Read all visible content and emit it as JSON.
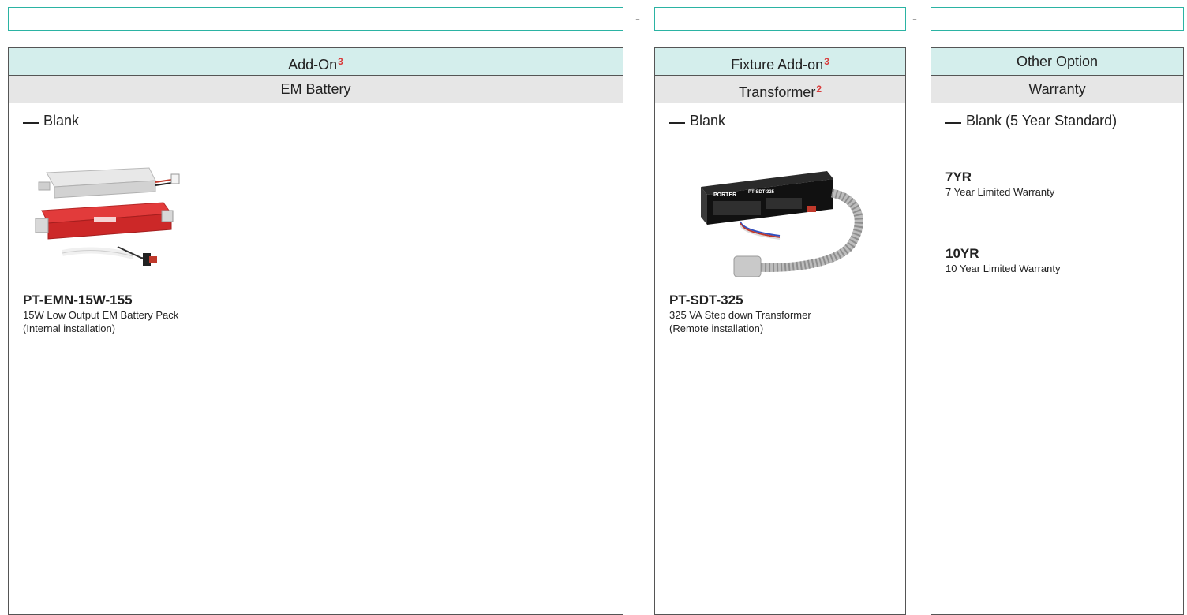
{
  "top_bar": {
    "input1": "",
    "input2": "",
    "input3": "",
    "sep1": "-",
    "sep2": "-"
  },
  "col1": {
    "header": "Add-On",
    "header_note": "3",
    "subheader": "EM Battery",
    "blank": "Blank",
    "item": {
      "code": "PT-EMN-15W-155",
      "desc1": "15W Low Output EM Battery Pack",
      "desc2": "(Internal installation)"
    }
  },
  "col2": {
    "header": "Fixture Add-on",
    "header_note": "3",
    "subheader": "Transformer",
    "subheader_note": "2",
    "blank": "Blank",
    "item": {
      "code": "PT-SDT-325",
      "desc1": "325 VA Step down Transformer",
      "desc2": "(Remote installation)",
      "brand": "PORTER"
    }
  },
  "col3": {
    "header": "Other Option",
    "subheader": "Warranty",
    "blank": "Blank (5 Year Standard)",
    "options": [
      {
        "code": "7YR",
        "desc": "7 Year Limited Warranty"
      },
      {
        "code": "10YR",
        "desc": "10 Year Limited Warranty"
      }
    ]
  },
  "colors": {
    "accent": "#2bb3a3",
    "header_bg": "#d4eeec",
    "subheader_bg": "#e6e6e6",
    "note": "#d93a3a"
  }
}
